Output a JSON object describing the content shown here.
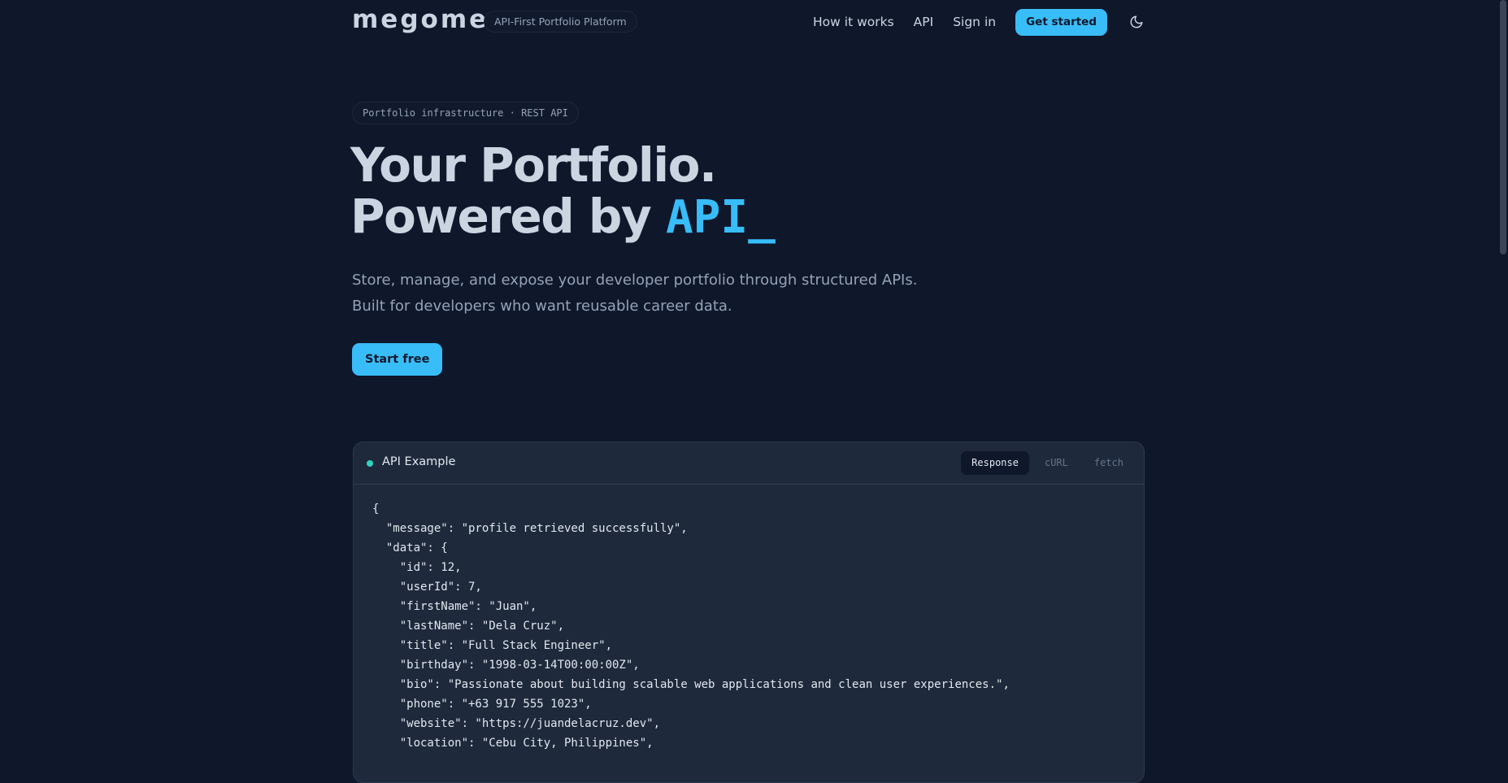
{
  "header": {
    "logo": "megome",
    "badge": "API-First Portfolio Platform",
    "nav": [
      "How it works",
      "API",
      "Sign in"
    ],
    "cta": "Get started",
    "theme_icon": "moon-icon"
  },
  "hero": {
    "eyebrow": "Portfolio infrastructure · REST API",
    "title_line1": "Your Portfolio.",
    "title_line2_prefix": "Powered by ",
    "title_line2_accent": "API_",
    "subtitle_line1": "Store, manage, and expose your developer portfolio through structured APIs.",
    "subtitle_line2": "Built for developers who want reusable career data.",
    "cta": "Start free"
  },
  "api_card": {
    "title": "API Example",
    "tabs": [
      "Response",
      "cURL",
      "fetch"
    ],
    "active_tab": "Response",
    "code_lines": [
      "{",
      "  \"message\": \"profile retrieved successfully\",",
      "  \"data\": {",
      "    \"id\": 12,",
      "    \"userId\": 7,",
      "    \"firstName\": \"Juan\",",
      "    \"lastName\": \"Dela Cruz\",",
      "    \"title\": \"Full Stack Engineer\",",
      "    \"birthday\": \"1998-03-14T00:00:00Z\",",
      "    \"bio\": \"Passionate about building scalable web applications and clean user experiences.\",",
      "    \"phone\": \"+63 917 555 1023\",",
      "    \"website\": \"https://juandelacruz.dev\",",
      "    \"location\": \"Cebu City, Philippines\","
    ]
  },
  "colors": {
    "background": "#0f172a",
    "accent": "#38bdf8",
    "card": "#1e293b",
    "status": "#2dd4bf"
  }
}
